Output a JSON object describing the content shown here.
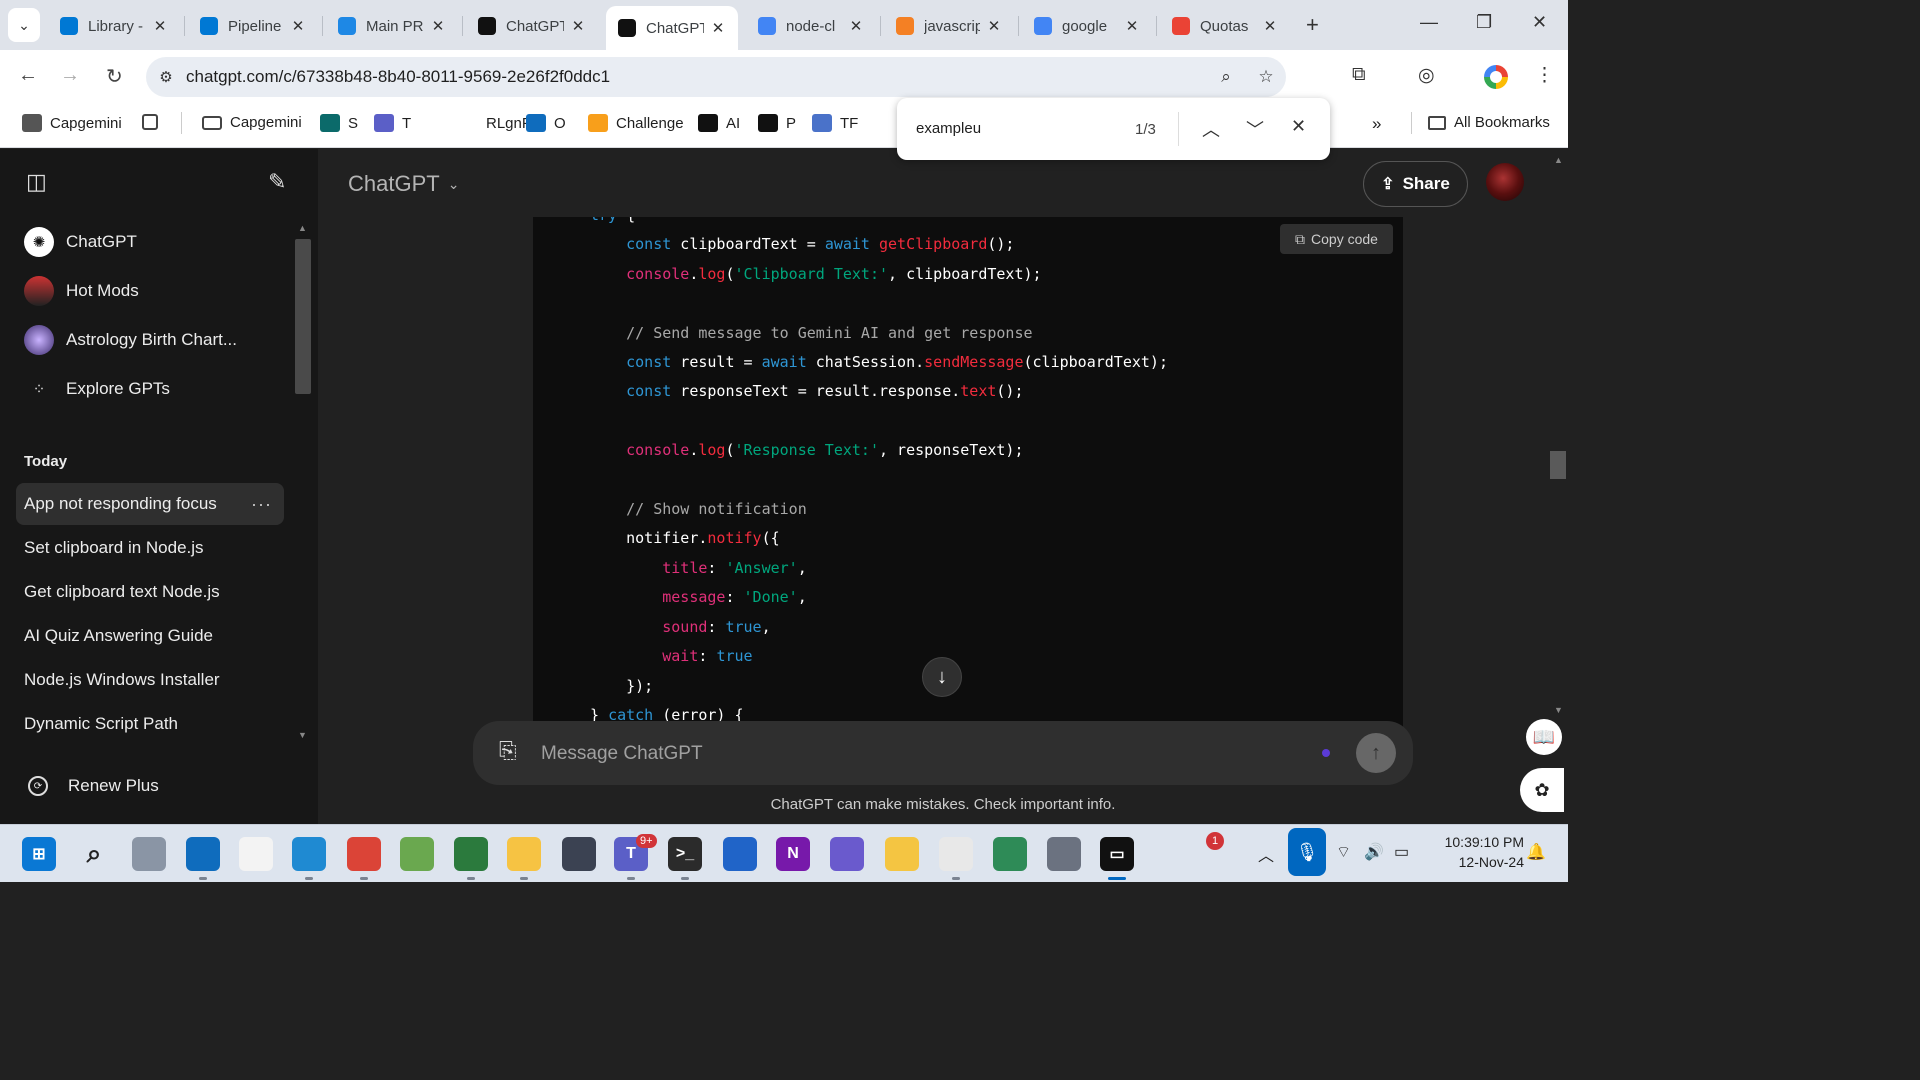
{
  "browser": {
    "tabs": [
      {
        "label": "Library -",
        "icon": "azure-devops-icon",
        "color": "#0078d4"
      },
      {
        "label": "Pipeline",
        "icon": "azure-devops-icon",
        "color": "#0078d4"
      },
      {
        "label": "Main PR",
        "icon": "azure-icon",
        "color": "#1e88e5"
      },
      {
        "label": "ChatGPT",
        "icon": "openai-icon",
        "color": "#111111"
      },
      {
        "label": "ChatGPT",
        "icon": "openai-icon",
        "color": "#111111",
        "active": true
      },
      {
        "label": "node-cl",
        "icon": "google-icon",
        "color": "#4285f4"
      },
      {
        "label": "javascrip",
        "icon": "stackoverflow-icon",
        "color": "#f48024"
      },
      {
        "label": "google",
        "icon": "google-icon",
        "color": "#4285f4"
      },
      {
        "label": "Quotas",
        "icon": "google-cloud-icon",
        "color": "#ea4335"
      }
    ],
    "url": "chatgpt.com/c/67338b48-8b40-8011-9569-2e26f2f0ddc1",
    "bookmarks": [
      {
        "label": "Capgemini",
        "icon": "capgemini-icon"
      },
      {
        "label": "",
        "icon": "apps-grid-icon"
      },
      {
        "label": "Capgemini",
        "icon": "folder-icon"
      },
      {
        "label": "S",
        "icon": "sharepoint-icon"
      },
      {
        "label": "T",
        "icon": "teams-icon"
      },
      {
        "label": "RLgnFst",
        "icon": "blank-icon"
      },
      {
        "label": "O",
        "icon": "onedrive-icon"
      },
      {
        "label": "Challenge",
        "icon": "leetcode-icon"
      },
      {
        "label": "AI",
        "icon": "openai-icon"
      },
      {
        "label": "P",
        "icon": "perplexity-icon"
      },
      {
        "label": "TF",
        "icon": "tensorflow-icon"
      }
    ],
    "all_bookmarks": "All Bookmarks",
    "more_bookmarks": "»",
    "find": {
      "query": "exampleu",
      "count": "1/3"
    }
  },
  "sidebar": {
    "pinned": [
      {
        "label": "ChatGPT",
        "icon": "openai-icon"
      },
      {
        "label": "Hot Mods",
        "icon": "car-avatar"
      },
      {
        "label": "Astrology Birth Chart...",
        "icon": "astrology-avatar"
      },
      {
        "label": "Explore GPTs",
        "icon": "grid-dots-icon"
      }
    ],
    "section": "Today",
    "history": [
      {
        "label": "App not responding focus",
        "active": true
      },
      {
        "label": "Set clipboard in Node.js"
      },
      {
        "label": "Get clipboard text Node.js"
      },
      {
        "label": "AI Quiz Answering Guide"
      },
      {
        "label": "Node.js Windows Installer"
      },
      {
        "label": "Dynamic Script Path"
      }
    ],
    "renew": "Renew Plus",
    "more": "···"
  },
  "main": {
    "model": "ChatGPT",
    "share": "Share",
    "copy_code": "Copy code",
    "composer_placeholder": "Message ChatGPT",
    "disclaimer": "ChatGPT can make mistakes. Check important info."
  },
  "code_lines": [
    [
      {
        "t": "try",
        "c": "kw"
      },
      {
        "t": " {",
        "c": ""
      }
    ],
    [
      {
        "t": "    ",
        "c": ""
      },
      {
        "t": "const",
        "c": "kw"
      },
      {
        "t": " clipboardText = ",
        "c": ""
      },
      {
        "t": "await",
        "c": "kw"
      },
      {
        "t": " ",
        "c": ""
      },
      {
        "t": "getClipboard",
        "c": "fn"
      },
      {
        "t": "();",
        "c": ""
      }
    ],
    [
      {
        "t": "    ",
        "c": ""
      },
      {
        "t": "console",
        "c": "prop"
      },
      {
        "t": ".",
        "c": ""
      },
      {
        "t": "log",
        "c": "fn"
      },
      {
        "t": "(",
        "c": ""
      },
      {
        "t": "'Clipboard Text:'",
        "c": "str"
      },
      {
        "t": ", clipboardText);",
        "c": ""
      }
    ],
    [],
    [
      {
        "t": "    // Send message to Gemini AI and get response",
        "c": "cm"
      }
    ],
    [
      {
        "t": "    ",
        "c": ""
      },
      {
        "t": "const",
        "c": "kw"
      },
      {
        "t": " result = ",
        "c": ""
      },
      {
        "t": "await",
        "c": "kw"
      },
      {
        "t": " chatSession.",
        "c": ""
      },
      {
        "t": "sendMessage",
        "c": "fn"
      },
      {
        "t": "(clipboardText);",
        "c": ""
      }
    ],
    [
      {
        "t": "    ",
        "c": ""
      },
      {
        "t": "const",
        "c": "kw"
      },
      {
        "t": " responseText = result.response.",
        "c": ""
      },
      {
        "t": "text",
        "c": "fn"
      },
      {
        "t": "();",
        "c": ""
      }
    ],
    [],
    [
      {
        "t": "    ",
        "c": ""
      },
      {
        "t": "console",
        "c": "prop"
      },
      {
        "t": ".",
        "c": ""
      },
      {
        "t": "log",
        "c": "fn"
      },
      {
        "t": "(",
        "c": ""
      },
      {
        "t": "'Response Text:'",
        "c": "str"
      },
      {
        "t": ", responseText);",
        "c": ""
      }
    ],
    [],
    [
      {
        "t": "    // Show notification",
        "c": "cm"
      }
    ],
    [
      {
        "t": "    notifier.",
        "c": ""
      },
      {
        "t": "notify",
        "c": "fn"
      },
      {
        "t": "({",
        "c": ""
      }
    ],
    [
      {
        "t": "        ",
        "c": ""
      },
      {
        "t": "title",
        "c": "prop"
      },
      {
        "t": ": ",
        "c": ""
      },
      {
        "t": "'Answer'",
        "c": "str"
      },
      {
        "t": ",",
        "c": ""
      }
    ],
    [
      {
        "t": "        ",
        "c": ""
      },
      {
        "t": "message",
        "c": "prop"
      },
      {
        "t": ": ",
        "c": ""
      },
      {
        "t": "'Done'",
        "c": "str"
      },
      {
        "t": ",",
        "c": ""
      }
    ],
    [
      {
        "t": "        ",
        "c": ""
      },
      {
        "t": "sound",
        "c": "prop"
      },
      {
        "t": ": ",
        "c": ""
      },
      {
        "t": "true",
        "c": "bool"
      },
      {
        "t": ",",
        "c": ""
      }
    ],
    [
      {
        "t": "        ",
        "c": ""
      },
      {
        "t": "wait",
        "c": "prop"
      },
      {
        "t": ": ",
        "c": ""
      },
      {
        "t": "true",
        "c": "bool"
      }
    ],
    [
      {
        "t": "    });",
        "c": ""
      }
    ],
    [
      {
        "t": "} ",
        "c": ""
      },
      {
        "t": "catch",
        "c": "kw"
      },
      {
        "t": " (error) {",
        "c": ""
      }
    ]
  ],
  "taskbar": {
    "apps": [
      "start-icon",
      "search-icon",
      "task-view-icon",
      "outlook-icon",
      "store-icon",
      "vscode-icon",
      "chrome-icon",
      "notepad-icon",
      "chrome-dev-icon",
      "file-explorer-icon",
      "vpn-lock-icon",
      "teams-icon",
      "terminal-icon",
      "settings-gear-icon",
      "onenote-icon",
      "notes-icon",
      "hand-icon",
      "snipping-icon",
      "globe-icon",
      "settings-icon",
      "cmd-icon"
    ],
    "teams_badge": "9+",
    "weather_badge": "1",
    "time": "10:39:10 PM",
    "date": "12-Nov-24"
  }
}
